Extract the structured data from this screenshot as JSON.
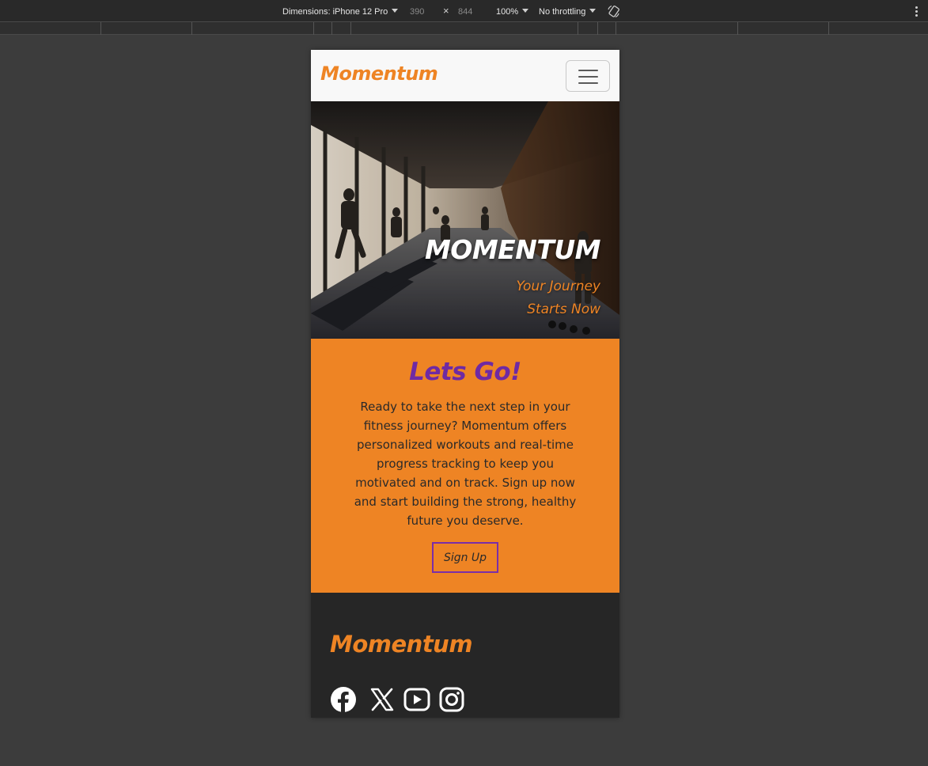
{
  "devtools": {
    "dimensions_label": "Dimensions: iPhone 12 Pro",
    "width": "390",
    "times": "×",
    "height": "844",
    "zoom": "100%",
    "throttling": "No throttling",
    "rotate_icon": "rotate-icon",
    "menu_icon": "kebab-menu-icon"
  },
  "navbar": {
    "brand": "Momentum",
    "toggler_icon": "hamburger-icon"
  },
  "hero": {
    "title": "MOMENTUM",
    "subtitle": "Your Journey Starts Now"
  },
  "cta": {
    "title": "Lets Go!",
    "text": "Ready to take the next step in your fitness journey? Momentum offers personalized workouts and real-time progress tracking to keep you motivated and on track. Sign up now and start building the strong, healthy future you deserve.",
    "button": "Sign Up"
  },
  "footer": {
    "brand": "Momentum",
    "social": [
      "facebook-icon",
      "x-icon",
      "youtube-icon",
      "instagram-icon"
    ]
  },
  "colors": {
    "brand_orange": "#ee8424",
    "brand_purple": "#6f2aa3",
    "footer_bg": "#262626",
    "navbar_bg": "#f8f8f8"
  }
}
